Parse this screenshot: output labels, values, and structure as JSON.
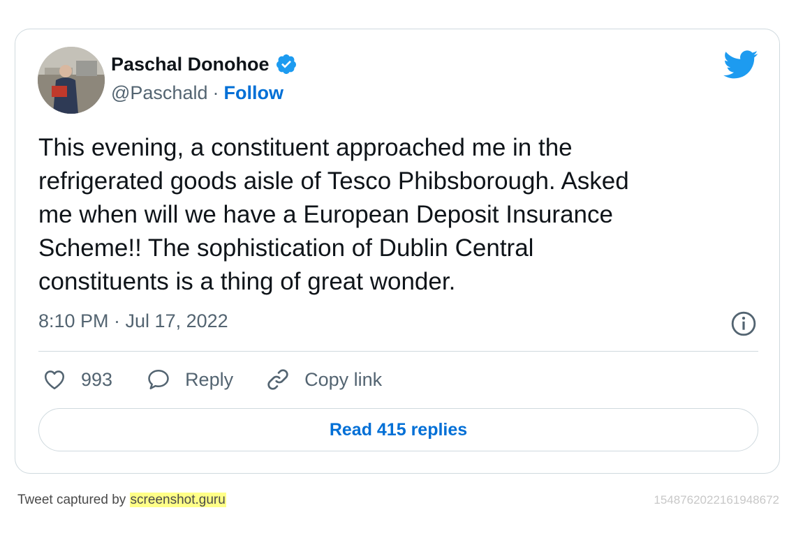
{
  "tweet": {
    "author_name": "Paschal Donohoe",
    "handle": "@Paschald",
    "separator": "·",
    "follow_label": "Follow",
    "text": "This evening, a constituent approached me in the\nrefrigerated goods aisle of Tesco Phibsborough. Asked\nme when will we have a European Deposit Insurance\nScheme!! The sophistication of Dublin Central\nconstituents is a thing of great wonder.",
    "timestamp": "8:10 PM · Jul 17, 2022",
    "likes_count": "993",
    "reply_label": "Reply",
    "copy_link_label": "Copy link",
    "read_replies_label": "Read 415 replies"
  },
  "footer": {
    "captured_by": "Tweet captured by ",
    "brand": "screenshot.guru",
    "tweet_id": "1548762022161948672"
  },
  "icons": {
    "verified": "verified-badge-icon",
    "twitter": "twitter-bird-icon",
    "info": "info-icon",
    "like": "heart-icon",
    "reply": "speech-bubble-icon",
    "copy_link": "link-icon"
  },
  "colors": {
    "accent": "#006fd6",
    "twitter_blue": "#1d9bf0",
    "muted_text": "#536471",
    "border": "#cfd9de",
    "brand_highlight": "#ffff88"
  }
}
